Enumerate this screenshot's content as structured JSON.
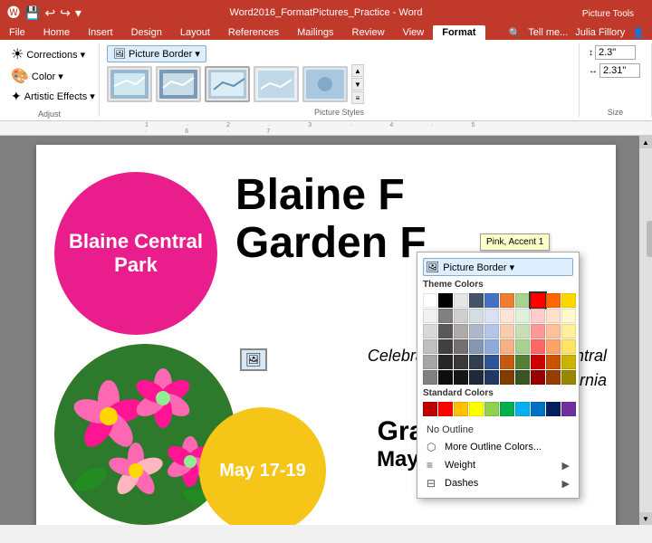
{
  "titleBar": {
    "title": "Word2016_FormatPictures_Practice - Word",
    "pictureToolsLabel": "Picture Tools",
    "minBtn": "─",
    "maxBtn": "□",
    "closeBtn": "✕",
    "userLabel": "Julia Fillory",
    "searchPlaceholder": "Tell me..."
  },
  "tabs": [
    {
      "id": "file",
      "label": "File",
      "active": false
    },
    {
      "id": "home",
      "label": "Home",
      "active": false
    },
    {
      "id": "insert",
      "label": "Insert",
      "active": false
    },
    {
      "id": "design",
      "label": "Design",
      "active": false
    },
    {
      "id": "layout",
      "label": "Layout",
      "active": false
    },
    {
      "id": "references",
      "label": "References",
      "active": false
    },
    {
      "id": "mailings",
      "label": "Mailings",
      "active": false
    },
    {
      "id": "review",
      "label": "Review",
      "active": false
    },
    {
      "id": "view",
      "label": "View",
      "active": false
    },
    {
      "id": "format",
      "label": "Format",
      "active": true
    }
  ],
  "ribbon": {
    "adjustGroup": {
      "label": "Adjust",
      "corrections": "Corrections ▾",
      "color": "Color ▾",
      "artisticEffects": "Artistic Effects ▾"
    },
    "pictureStylesGroup": {
      "label": "Picture Styles"
    },
    "sizeGroup": {
      "label": "Size",
      "height": "2.3\"",
      "width": "2.31\""
    },
    "pictureBorderBtn": "Picture Border ▾"
  },
  "colorPicker": {
    "themeColorsLabel": "Theme Colors",
    "standardColorsLabel": "Standard Colors",
    "noOutlineLabel": "No Outline",
    "moreOutlineColorsLabel": "More Outline Colors...",
    "weightLabel": "Weight",
    "dashesLabel": "Dashes",
    "tooltip": "Pink, Accent 1",
    "themeColors": [
      "#ffffff",
      "#000000",
      "#e7e6e6",
      "#44546a",
      "#4472c4",
      "#ed7d31",
      "#a9d18e",
      "#ff0000",
      "#ff6600",
      "#ffd700",
      "#f2f2f2",
      "#808080",
      "#d0cece",
      "#d6dce4",
      "#d9e1f2",
      "#fce4d6",
      "#e2efda",
      "#ffcccc",
      "#ffe0cc",
      "#fffacc",
      "#d9d9d9",
      "#595959",
      "#aeaaaa",
      "#adb9ca",
      "#b4c6e7",
      "#f8cbad",
      "#c6e0b4",
      "#ff9999",
      "#ffc19a",
      "#fff099",
      "#bfbfbf",
      "#404040",
      "#757070",
      "#8496b0",
      "#8eaadb",
      "#f4b183",
      "#a9d18e",
      "#ff6666",
      "#ffa266",
      "#ffe566",
      "#a6a6a6",
      "#262626",
      "#3a3838",
      "#323f4f",
      "#2f5496",
      "#c55a11",
      "#538135",
      "#cc0000",
      "#cc5200",
      "#ccb300",
      "#808080",
      "#0d0d0d",
      "#171616",
      "#1f2739",
      "#1f3864",
      "#833c00",
      "#375623",
      "#990000",
      "#993d00",
      "#998600"
    ],
    "selectedColorIndex": 7,
    "standardColors": [
      "#c00000",
      "#ff0000",
      "#ffc000",
      "#ffff00",
      "#92d050",
      "#00b050",
      "#00b0f0",
      "#0070c0",
      "#002060",
      "#7030a0"
    ]
  },
  "document": {
    "pinkCircleText": "Blaine Central Park",
    "yellowCircleText": "May 17-19",
    "mainTitle": "Blaine F…\nGarden F…",
    "mainTitleFull": "Blaine Flower Garden Festival",
    "subtitle": "Celebrating the beauty of Central California",
    "paradeTitleLabel": "Grand Parade",
    "paradeDateLabel": "May 18, 10:00 AM"
  }
}
